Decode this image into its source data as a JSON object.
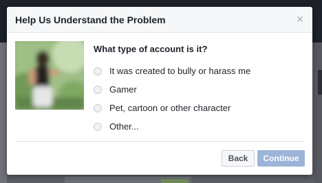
{
  "dialog": {
    "title": "Help Us Understand the Problem",
    "close_icon": "×",
    "question": "What type of account is it?",
    "options": [
      {
        "label": "It was created to bully or harass me",
        "selected": false
      },
      {
        "label": "Gamer",
        "selected": false
      },
      {
        "label": "Pet, cartoon or other character",
        "selected": false
      },
      {
        "label": "Other...",
        "selected": false
      }
    ],
    "back_label": "Back",
    "continue_label": "Continue",
    "continue_enabled": false
  },
  "colors": {
    "continue_disabled": "#9cb4d8",
    "header_bg": "#f6f7f9",
    "title_text": "#1d2129"
  }
}
